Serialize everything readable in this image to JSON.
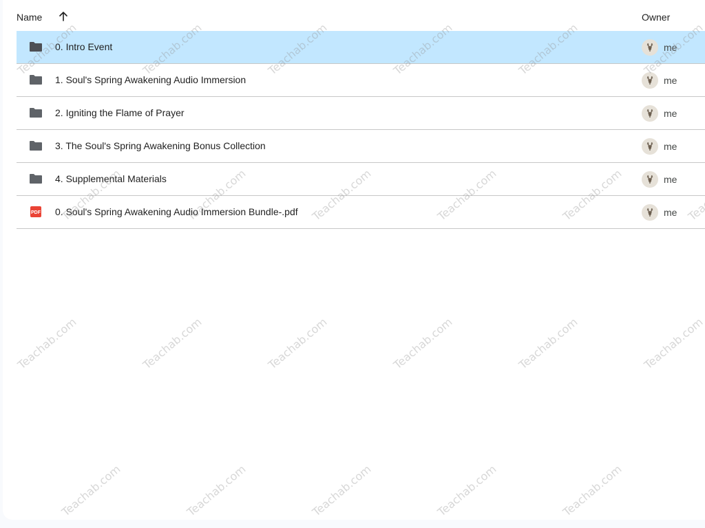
{
  "header": {
    "name_label": "Name",
    "owner_label": "Owner",
    "sort_icon": "arrow-upward-icon"
  },
  "files": [
    {
      "name": "0. Intro Event",
      "type": "folder",
      "owner": "me",
      "selected": true
    },
    {
      "name": "1. Soul's Spring Awakening Audio Immersion",
      "type": "folder",
      "owner": "me",
      "selected": false
    },
    {
      "name": "2. Igniting the Flame of Prayer",
      "type": "folder",
      "owner": "me",
      "selected": false
    },
    {
      "name": "3. The Soul's Spring Awakening Bonus Collection",
      "type": "folder",
      "owner": "me",
      "selected": false
    },
    {
      "name": "4. Supplemental Materials",
      "type": "folder",
      "owner": "me",
      "selected": false
    },
    {
      "name": "0. Soul's Spring Awakening Audio Immersion Bundle-.pdf",
      "type": "pdf",
      "owner": "me",
      "selected": false
    }
  ],
  "pdf_badge": "PDF",
  "watermark": "Teachab.com",
  "colors": {
    "selected_row": "#c2e7ff",
    "folder_icon": "#5f6368",
    "pdf_icon": "#ea4335"
  }
}
